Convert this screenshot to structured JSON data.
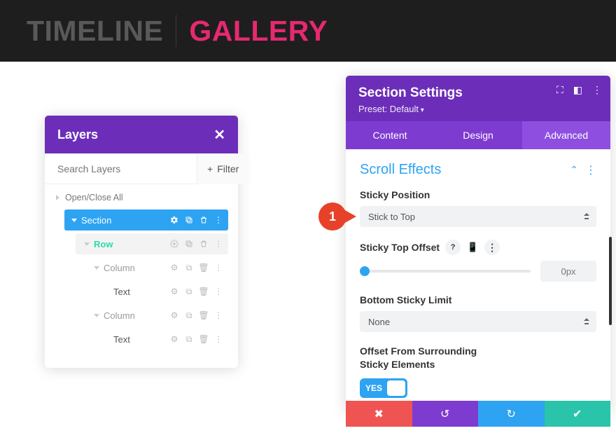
{
  "topbar": {
    "timeline": "TIMELINE",
    "gallery": "GALLERY"
  },
  "layers": {
    "title": "Layers",
    "search_placeholder": "Search Layers",
    "filter_label": "Filter",
    "open_close": "Open/Close All",
    "rows": {
      "section": "Section",
      "row": "Row",
      "column": "Column",
      "text": "Text"
    }
  },
  "settings": {
    "title": "Section Settings",
    "preset": "Preset: Default",
    "tabs": {
      "content": "Content",
      "design": "Design",
      "advanced": "Advanced"
    },
    "scroll_effects": "Scroll Effects",
    "sticky_position": {
      "label": "Sticky Position",
      "value": "Stick to Top"
    },
    "sticky_top_offset": {
      "label": "Sticky Top Offset",
      "value": "0px"
    },
    "bottom_sticky_limit": {
      "label": "Bottom Sticky Limit",
      "value": "None"
    },
    "offset_surrounding": {
      "label_line1": "Offset From Surrounding",
      "label_line2": "Sticky Elements",
      "value": "YES"
    }
  },
  "badge": {
    "number": "1"
  }
}
